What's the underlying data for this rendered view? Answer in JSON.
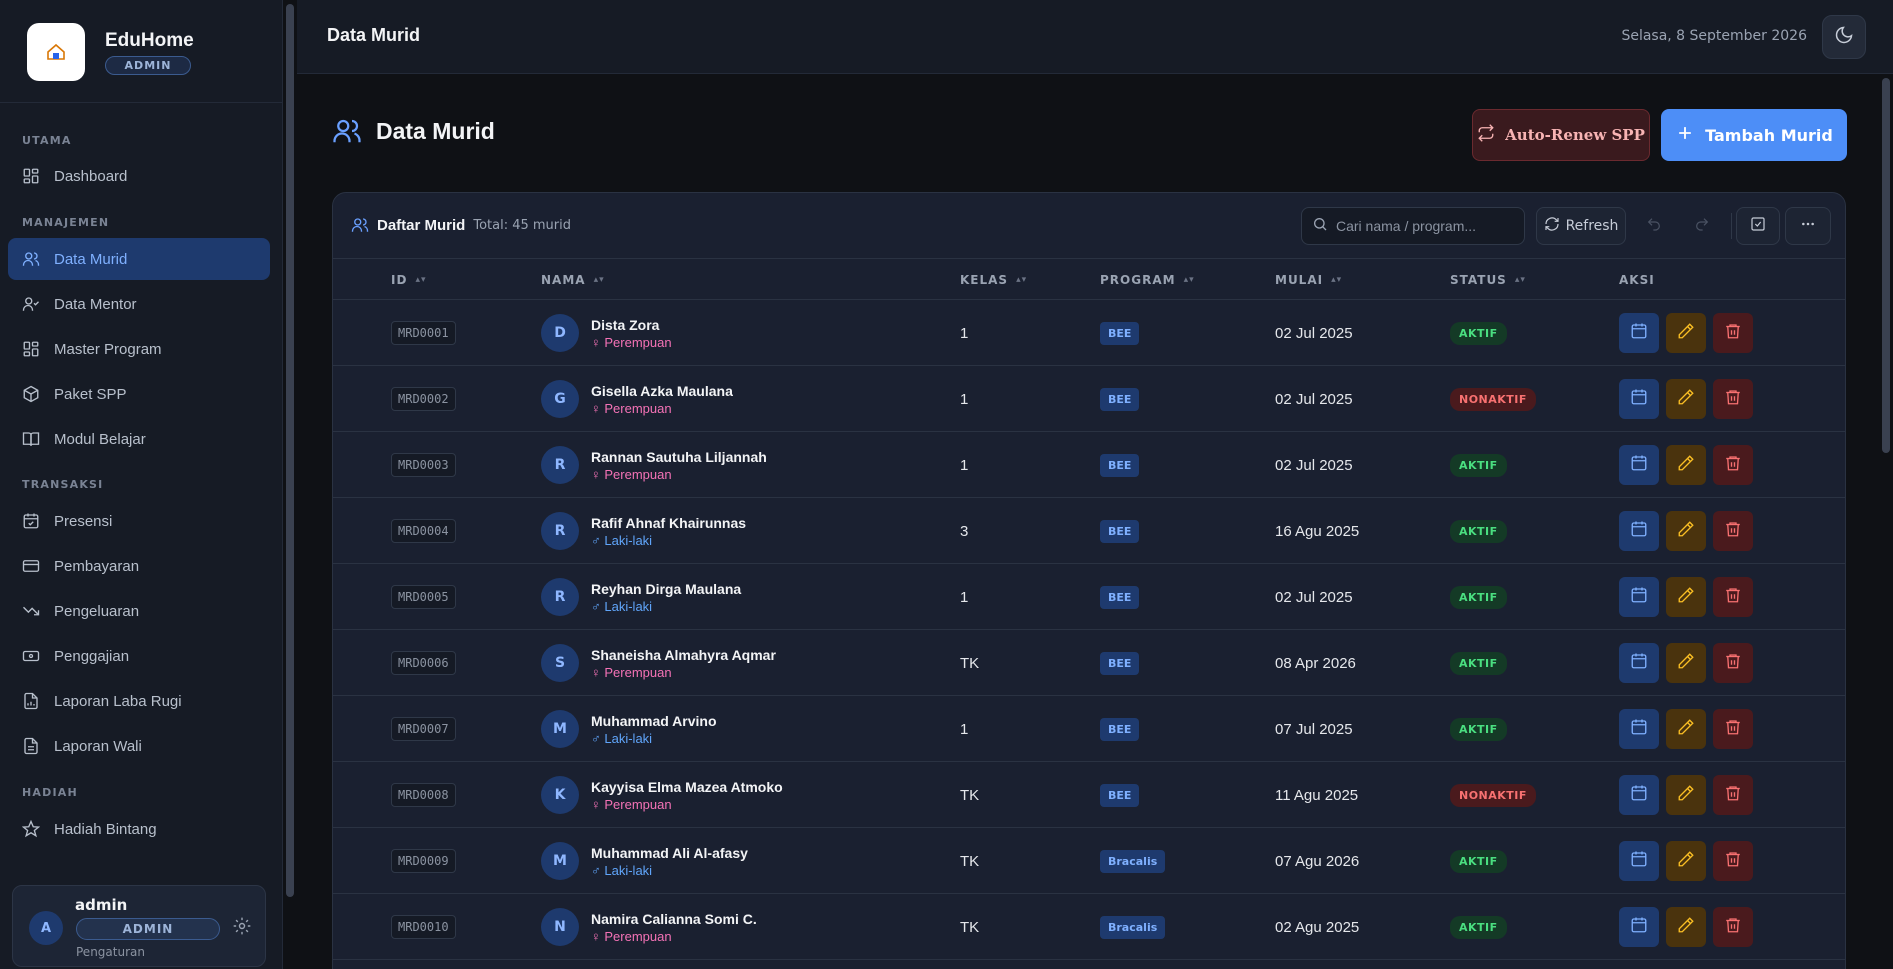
{
  "brand": {
    "name": "EduHome",
    "badge": "ADMIN"
  },
  "sidebar": {
    "sections": [
      {
        "label": "UTAMA"
      },
      {
        "label": "MANAJEMEN"
      },
      {
        "label": "TRANSAKSI"
      },
      {
        "label": "HADIAH"
      }
    ],
    "items": [
      {
        "label": "Dashboard",
        "icon": "grid-icon",
        "active": false
      },
      {
        "label": "Data Murid",
        "icon": "users-icon",
        "active": true
      },
      {
        "label": "Data Mentor",
        "icon": "user-check-icon",
        "active": false
      },
      {
        "label": "Master Program",
        "icon": "grid-icon",
        "active": false
      },
      {
        "label": "Paket SPP",
        "icon": "package-icon",
        "active": false
      },
      {
        "label": "Modul Belajar",
        "icon": "book-icon",
        "active": false
      },
      {
        "label": "Presensi",
        "icon": "calendar-check-icon",
        "active": false
      },
      {
        "label": "Pembayaran",
        "icon": "credit-card-icon",
        "active": false
      },
      {
        "label": "Pengeluaran",
        "icon": "trending-down-icon",
        "active": false
      },
      {
        "label": "Penggajian",
        "icon": "banknote-icon",
        "active": false
      },
      {
        "label": "Laporan Laba Rugi",
        "icon": "file-chart-icon",
        "active": false
      },
      {
        "label": "Laporan Wali",
        "icon": "file-text-icon",
        "active": false
      },
      {
        "label": "Hadiah Bintang",
        "icon": "star-icon",
        "active": false
      }
    ]
  },
  "user": {
    "initial": "A",
    "name": "admin",
    "role": "ADMIN",
    "settings_label": "Pengaturan"
  },
  "topbar": {
    "title": "Data Murid",
    "date": "Selasa, 8 September 2026"
  },
  "page": {
    "title": "Data Murid",
    "renew_label": "Auto-Renew SPP",
    "add_label": "Tambah Murid"
  },
  "card": {
    "title": "Daftar Murid",
    "total": "Total: 45 murid",
    "search_placeholder": "Cari nama / program...",
    "refresh_label": "Refresh"
  },
  "columns": [
    "ID",
    "NAMA",
    "KELAS",
    "PROGRAM",
    "MULAI",
    "STATUS",
    "AKSI"
  ],
  "rows": [
    {
      "id": "MRD0001",
      "initial": "D",
      "name": "Dista Zora",
      "gender": "Perempuan",
      "gender_symbol": "♀",
      "kelas": "1",
      "program": "BEE",
      "mulai": "02 Jul 2025",
      "status": "AKTIF"
    },
    {
      "id": "MRD0002",
      "initial": "G",
      "name": "Gisella Azka Maulana",
      "gender": "Perempuan",
      "gender_symbol": "♀",
      "kelas": "1",
      "program": "BEE",
      "mulai": "02 Jul 2025",
      "status": "NONAKTIF"
    },
    {
      "id": "MRD0003",
      "initial": "R",
      "name": "Rannan Sautuha Liljannah",
      "gender": "Perempuan",
      "gender_symbol": "♀",
      "kelas": "1",
      "program": "BEE",
      "mulai": "02 Jul 2025",
      "status": "AKTIF"
    },
    {
      "id": "MRD0004",
      "initial": "R",
      "name": "Rafif Ahnaf Khairunnas",
      "gender": "Laki-laki",
      "gender_symbol": "♂",
      "kelas": "3",
      "program": "BEE",
      "mulai": "16 Agu 2025",
      "status": "AKTIF"
    },
    {
      "id": "MRD0005",
      "initial": "R",
      "name": "Reyhan Dirga Maulana",
      "gender": "Laki-laki",
      "gender_symbol": "♂",
      "kelas": "1",
      "program": "BEE",
      "mulai": "02 Jul 2025",
      "status": "AKTIF"
    },
    {
      "id": "MRD0006",
      "initial": "S",
      "name": "Shaneisha Almahyra Aqmar",
      "gender": "Perempuan",
      "gender_symbol": "♀",
      "kelas": "TK",
      "program": "BEE",
      "mulai": "08 Apr 2026",
      "status": "AKTIF"
    },
    {
      "id": "MRD0007",
      "initial": "M",
      "name": "Muhammad Arvino",
      "gender": "Laki-laki",
      "gender_symbol": "♂",
      "kelas": "1",
      "program": "BEE",
      "mulai": "07 Jul 2025",
      "status": "AKTIF"
    },
    {
      "id": "MRD0008",
      "initial": "K",
      "name": "Kayyisa Elma Mazea Atmoko",
      "gender": "Perempuan",
      "gender_symbol": "♀",
      "kelas": "TK",
      "program": "BEE",
      "mulai": "11 Agu 2025",
      "status": "NONAKTIF"
    },
    {
      "id": "MRD0009",
      "initial": "M",
      "name": "Muhammad Ali Al-afasy",
      "gender": "Laki-laki",
      "gender_symbol": "♂",
      "kelas": "TK",
      "program": "Bracalis",
      "mulai": "07 Agu 2026",
      "status": "AKTIF"
    },
    {
      "id": "MRD0010",
      "initial": "N",
      "name": "Namira Calianna Somi C.",
      "gender": "Perempuan",
      "gender_symbol": "♀",
      "kelas": "TK",
      "program": "Bracalis",
      "mulai": "02 Agu 2025",
      "status": "AKTIF"
    }
  ]
}
